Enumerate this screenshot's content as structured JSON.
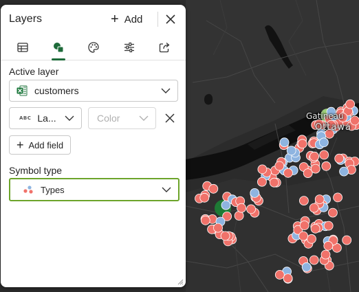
{
  "panel": {
    "title": "Layers",
    "add_label": "Add",
    "tabs": [
      {
        "name": "table-icon",
        "active": false
      },
      {
        "name": "shapes-icon",
        "active": true
      },
      {
        "name": "palette-icon",
        "active": false
      },
      {
        "name": "sliders-icon",
        "active": false
      },
      {
        "name": "share-icon",
        "active": false
      }
    ],
    "active_layer": {
      "label": "Active layer",
      "value": "customers",
      "icon": "excel-icon"
    },
    "label_field": {
      "badge": "ABC",
      "value": "La..."
    },
    "color_field": {
      "placeholder": "Color"
    },
    "add_field_label": "Add field",
    "symbol_type": {
      "label": "Symbol type",
      "value": "Types",
      "icon": "types-icon"
    }
  },
  "map": {
    "place_labels": [
      "Gatineau",
      "Ottawa"
    ],
    "colors": {
      "background": "#2b2b2b",
      "water": "#0f0f0f",
      "point_primary": "#f0726a",
      "point_secondary": "#8eb4e0",
      "point_cluster": "#1e7a35",
      "highlight": "#9ed07a"
    }
  }
}
